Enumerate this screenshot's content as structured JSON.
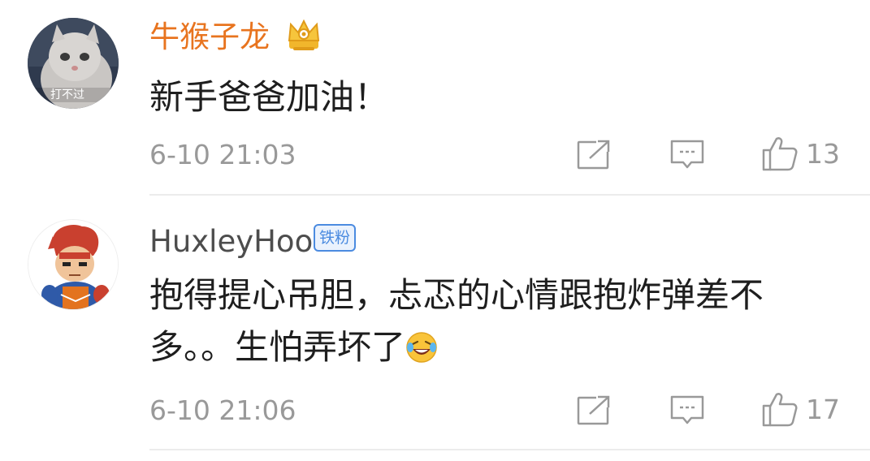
{
  "comments": [
    {
      "username": "牛猴子龙",
      "username_color": "#e8741f",
      "badge": "crown",
      "avatar_watermark": "打不过",
      "text": "新手爸爸加油！",
      "time": "6-10 21:03",
      "likes": "13"
    },
    {
      "username": "HuxleyHoo",
      "username_color": "#4d4d4d",
      "badge_label": "铁粉",
      "badge_color": "#4b8be0",
      "text": "抱得提心吊胆，忐忑的心情跟抱炸弹差不多。。生怕弄坏了",
      "emoji": "laugh-cry-emoji",
      "time": "6-10 21:06",
      "likes": "17"
    }
  ],
  "icons": {
    "share": "share-icon",
    "reply": "comment-icon",
    "like": "thumbs-up-icon"
  }
}
